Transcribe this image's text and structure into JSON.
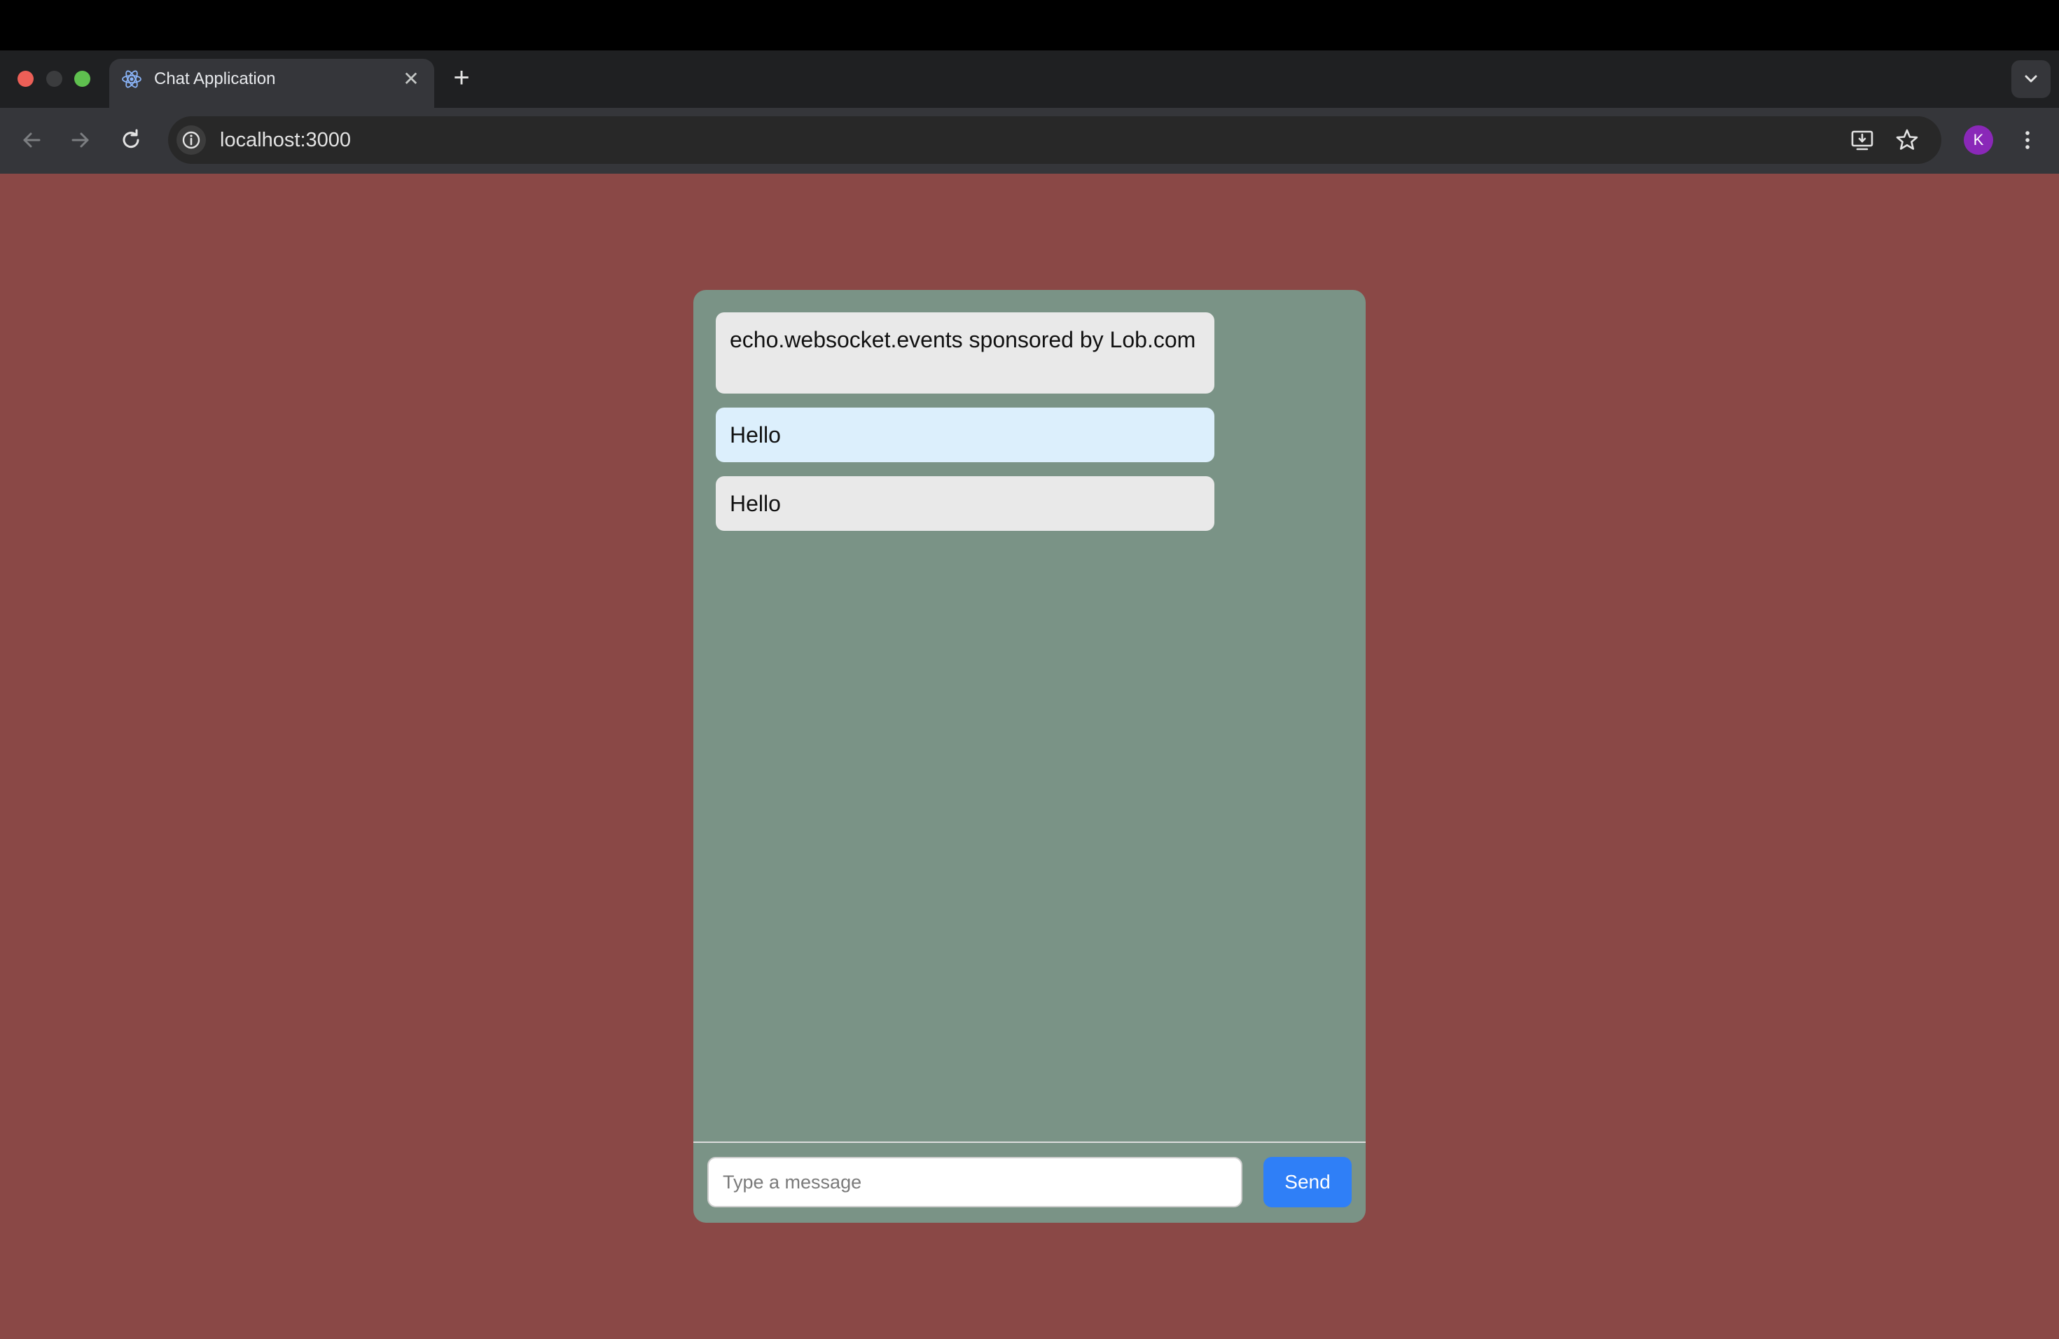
{
  "browser": {
    "tab": {
      "title": "Chat Application",
      "favicon": "react-atom-icon",
      "close_glyph": "✕"
    },
    "new_tab_glyph": "+",
    "address_bar": {
      "url": "localhost:3000"
    },
    "profile_initial": "K",
    "colors": {
      "tabstrip": "#1f2022",
      "toolbar": "#35363a",
      "omnibox": "#282828",
      "avatar": "#8a28b8"
    }
  },
  "chat": {
    "messages": [
      {
        "text": "echo.websocket.events sponsored by Lob.com",
        "kind": "received"
      },
      {
        "text": "Hello",
        "kind": "sent"
      },
      {
        "text": "Hello",
        "kind": "received"
      }
    ],
    "composer": {
      "placeholder": "Type a message",
      "value": "",
      "send_label": "Send"
    },
    "colors": {
      "page_background": "#8a4846",
      "panel_background": "#7a9386",
      "received_bubble": "#e9e9e9",
      "sent_bubble": "#dceffc",
      "send_button": "#2f7ff7"
    }
  }
}
